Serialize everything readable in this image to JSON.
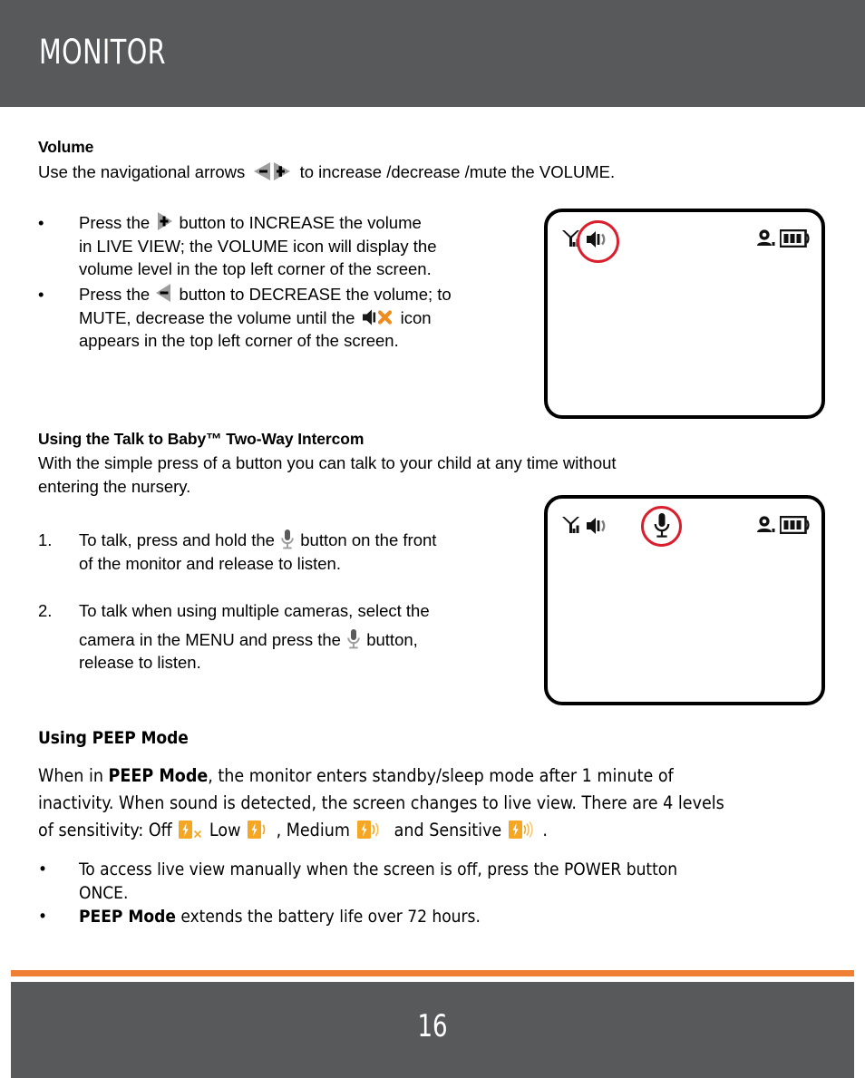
{
  "header": {
    "title": "MONITOR"
  },
  "footer": {
    "page_number": "16",
    "rule_color": "#ef7f32",
    "bar_color": "#58595b"
  },
  "colors": {
    "header_gray": "#58595b",
    "accent_orange": "#ef7f32",
    "highlight_red": "#d91f2d",
    "icon_gray": "#9d9d9d",
    "text_black": "#000000"
  },
  "sections": {
    "volume": {
      "heading": "Volume",
      "intro_before": "Use the navigational arrows",
      "intro_after": "to increase /decrease /mute the VOLUME.",
      "bullets": [
        {
          "marker": "•",
          "before_icon": "Press the",
          "icon": "plus-arrow-icon",
          "after_icon": "button to INCREASE the volume",
          "lines": [
            "in LIVE VIEW; the VOLUME icon will display the",
            "volume level in the top left corner of the screen."
          ]
        },
        {
          "marker": "•",
          "before_icon": "Press the",
          "icon": "minus-arrow-icon",
          "after_icon": "button to DECREASE the volume; to",
          "line2_before_icon": "MUTE, decrease the volume until the",
          "line2_icon": "speaker-mute-icon",
          "line2_after_icon": "icon",
          "lines": [
            "appears in the top left corner of the screen."
          ]
        }
      ]
    },
    "intercom": {
      "heading": "Using the Talk to Baby™ Two-Way Intercom",
      "paragraph_lines": [
        "With the simple press of a button you can talk to your child at any time without",
        "entering the nursery."
      ],
      "items": [
        {
          "marker": "1.",
          "before_icon": "To talk, press and hold the",
          "icon": "microphone-icon",
          "after_icon": "button on the front",
          "lines": [
            "of the monitor and release to listen."
          ]
        },
        {
          "marker": "2.",
          "line1": "To talk when using multiple cameras, select the",
          "before_icon": "camera in the MENU and press the",
          "icon": "microphone-icon",
          "after_icon": "button,",
          "lines": [
            "release to listen."
          ]
        }
      ]
    },
    "peep": {
      "heading": "Using PEEP Mode",
      "para_line1_a": "When in ",
      "para_line1_bold": "PEEP Mode",
      "para_line1_b": ", the monitor enters standby/sleep mode after 1 minute of",
      "para_line2": "inactivity. When sound is detected, the screen changes to live view. There are 4 levels",
      "sensitivity_prefix": "of sensitivity:",
      "levels": [
        {
          "label": "Off",
          "icon": "peep-off-icon",
          "waves": 0,
          "has_x": true
        },
        {
          "label": "Low",
          "icon": "peep-low-icon",
          "waves": 1,
          "has_x": false
        },
        {
          "label": "Medium",
          "icon": "peep-medium-icon",
          "waves": 2,
          "has_x": false
        },
        {
          "label": "Sensitive",
          "icon": "peep-sensitive-icon",
          "waves": 3,
          "has_x": false
        }
      ],
      "level_separators": [
        "",
        ",",
        "",
        "."
      ],
      "and_word": "and",
      "bullets": [
        {
          "marker": "•",
          "lines": [
            "To access live view manually when the screen is off, press the POWER button",
            "ONCE."
          ]
        },
        {
          "marker": "•",
          "bold_lead": "PEEP Mode",
          "rest": " extends the battery life over 72 hours."
        }
      ]
    }
  },
  "screen_mockups": [
    {
      "name": "volume-screen-mockup",
      "status_icons": [
        "signal-icon",
        "speaker-on-icon",
        "camera-icon",
        "battery-icon"
      ],
      "highlighted_icon": "speaker-on-icon",
      "battery_bars": 3
    },
    {
      "name": "intercom-screen-mockup",
      "status_icons": [
        "signal-icon",
        "speaker-on-icon",
        "microphone-icon",
        "camera-icon",
        "battery-icon"
      ],
      "highlighted_icon": "microphone-icon",
      "battery_bars": 3
    }
  ]
}
